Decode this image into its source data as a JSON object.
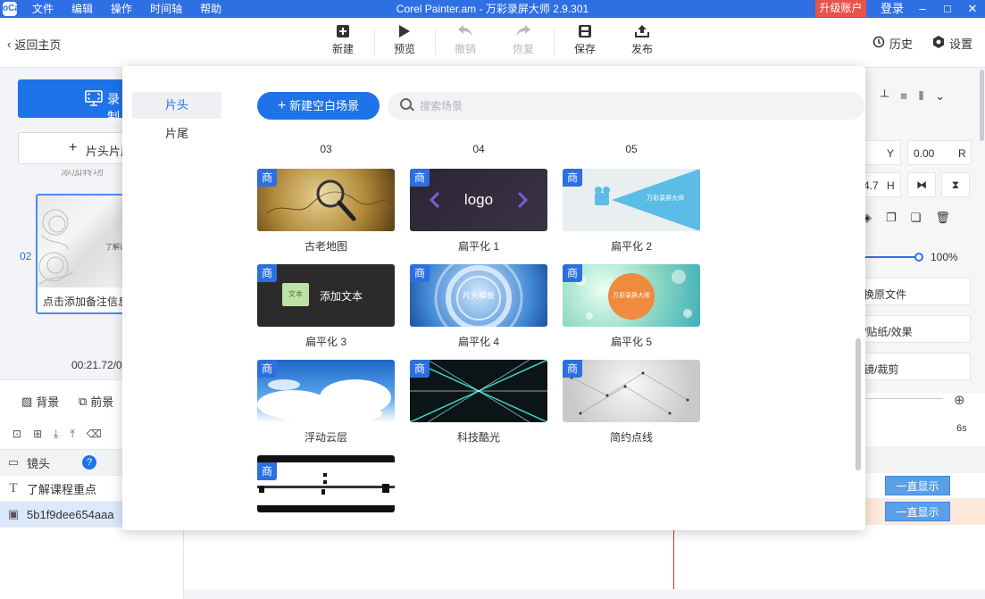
{
  "titlebar": {
    "app_icon": "oCam",
    "menu": [
      "文件",
      "编辑",
      "操作",
      "时间轴",
      "帮助"
    ],
    "title": "Corel Painter.am - 万彩录屏大师 2.9.301",
    "upgrade": "升级账户",
    "login": "登录",
    "minimize": "‒",
    "restore": "□",
    "close": "✕"
  },
  "toolbar": {
    "back": "返回主页",
    "buttons": [
      {
        "label": "新建",
        "icon": "new-icon",
        "disabled": false
      },
      {
        "label": "预览",
        "icon": "play-icon",
        "disabled": false
      },
      {
        "label": "撤销",
        "icon": "undo-icon",
        "disabled": true
      },
      {
        "label": "恢复",
        "icon": "redo-icon",
        "disabled": true
      },
      {
        "label": "保存",
        "icon": "save-icon",
        "disabled": false
      },
      {
        "label": "发布",
        "icon": "publish-icon",
        "disabled": false
      }
    ],
    "history": "历史",
    "settings": "设置"
  },
  "left": {
    "record": "录制",
    "intro": "片头片尾",
    "scene_hidden_label": "添加转场",
    "scene_number": "02",
    "scene_thumb_text": "了解课",
    "scene_note": "点击添加备注信息",
    "time": "00:21.72/0"
  },
  "layers": {
    "tab_background": "背景",
    "tab_foreground": "前景",
    "rows": [
      {
        "icon": "camera-icon",
        "label": "镜头"
      },
      {
        "icon": "text-icon",
        "label": "了解课程重点"
      },
      {
        "icon": "image-icon",
        "label": "5b1f9dee654aaa"
      }
    ],
    "help": "?"
  },
  "props": {
    "y_label": "Y",
    "y_value": "0.00",
    "r_label": "R",
    "h_value": "4.7",
    "h_label": "H",
    "opacity": "100%",
    "restore_file": "换原文件",
    "stickers": "/贴纸/效果",
    "mirror_crop": "镜/裁剪",
    "timeline_end": "6s",
    "always_show_1": "一直显示",
    "always_show_2": "一直显示"
  },
  "modal": {
    "tabs": [
      "片头",
      "片尾"
    ],
    "new_scene": "新建空白场景",
    "search_placeholder": "搜索场景",
    "column_numbers": [
      "03",
      "04",
      "05"
    ],
    "badge": "商",
    "templates": [
      {
        "label": "古老地图",
        "style": "map"
      },
      {
        "label": "扁平化 1",
        "style": "flat1",
        "text": "logo"
      },
      {
        "label": "扁平化 2",
        "style": "flat2",
        "text": "万彩录屏大师"
      },
      {
        "label": "扁平化 3",
        "style": "flat3",
        "text": "添加文本",
        "chip": "文本"
      },
      {
        "label": "扁平化 4",
        "style": "flat4",
        "text": "片头模板"
      },
      {
        "label": "扁平化 5",
        "style": "flat5",
        "text": "万彩录屏大师"
      },
      {
        "label": "浮动云层",
        "style": "clouds"
      },
      {
        "label": "科技酷光",
        "style": "tech"
      },
      {
        "label": "简约点线",
        "style": "dots"
      },
      {
        "label": "",
        "style": "film"
      }
    ]
  }
}
